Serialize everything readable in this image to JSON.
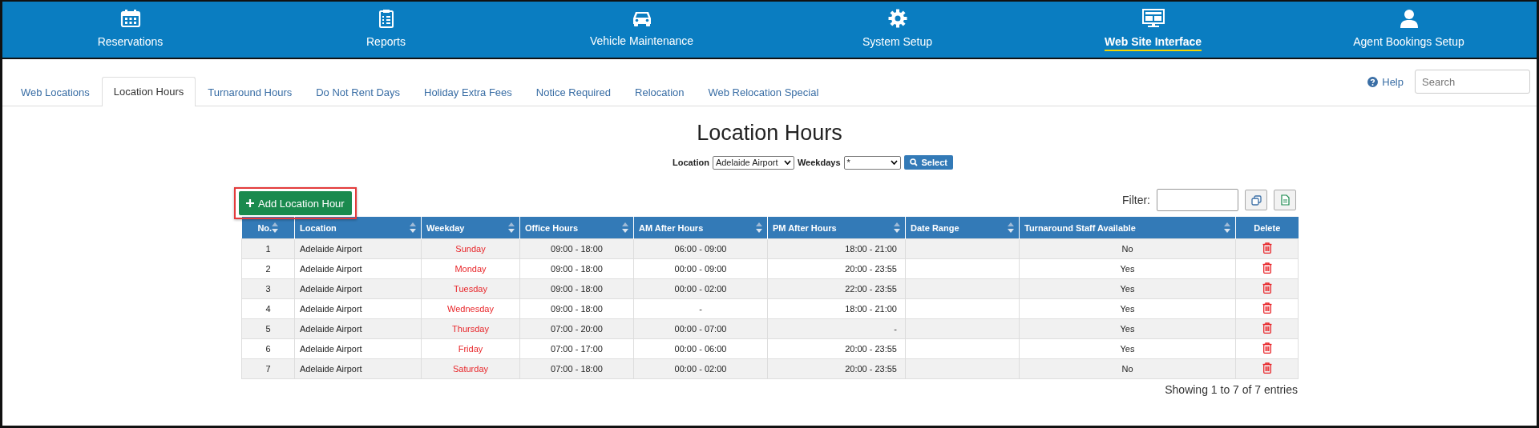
{
  "nav": [
    {
      "label": "Reservations",
      "selected": false
    },
    {
      "label": "Reports",
      "selected": false
    },
    {
      "label": "Vehicle Maintenance",
      "selected": false
    },
    {
      "label": "System Setup",
      "selected": false
    },
    {
      "label": "Web Site Interface",
      "selected": true
    },
    {
      "label": "Agent Bookings Setup",
      "selected": false
    }
  ],
  "tabs": [
    {
      "label": "Web Locations",
      "selected": false
    },
    {
      "label": "Location Hours",
      "selected": true
    },
    {
      "label": "Turnaround Hours",
      "selected": false
    },
    {
      "label": "Do Not Rent Days",
      "selected": false
    },
    {
      "label": "Holiday Extra Fees",
      "selected": false
    },
    {
      "label": "Notice Required",
      "selected": false
    },
    {
      "label": "Relocation",
      "selected": false
    },
    {
      "label": "Web Relocation Special",
      "selected": false
    }
  ],
  "help": "Help",
  "search": {
    "placeholder": "Search"
  },
  "title": "Location Hours",
  "form": {
    "location_label": "Location",
    "location_value": "Adelaide Airport",
    "weekdays_label": "Weekdays",
    "weekdays_value": "*",
    "select_button": "Select"
  },
  "add_button": "Add Location Hour",
  "filter_label": "Filter:",
  "table": {
    "columns": [
      "No.",
      "Location",
      "Weekday",
      "Office Hours",
      "AM After Hours",
      "PM After Hours",
      "Date Range",
      "Turnaround Staff Available",
      "Delete"
    ],
    "rows": [
      [
        "1",
        "Adelaide Airport",
        "Sunday",
        "09:00 - 18:00",
        "06:00 - 09:00",
        "18:00 - 21:00",
        "",
        "No"
      ],
      [
        "2",
        "Adelaide Airport",
        "Monday",
        "09:00 - 18:00",
        "00:00 - 09:00",
        "20:00 - 23:55",
        "",
        "Yes"
      ],
      [
        "3",
        "Adelaide Airport",
        "Tuesday",
        "09:00 - 18:00",
        "00:00 - 02:00",
        "22:00 - 23:55",
        "",
        "Yes"
      ],
      [
        "4",
        "Adelaide Airport",
        "Wednesday",
        "09:00 - 18:00",
        "-",
        "18:00 - 21:00",
        "",
        "Yes"
      ],
      [
        "5",
        "Adelaide Airport",
        "Thursday",
        "07:00 - 20:00",
        "00:00 - 07:00",
        "-",
        "",
        "Yes"
      ],
      [
        "6",
        "Adelaide Airport",
        "Friday",
        "07:00 - 17:00",
        "00:00 - 06:00",
        "20:00 - 23:55",
        "",
        "Yes"
      ],
      [
        "7",
        "Adelaide Airport",
        "Saturday",
        "07:00 - 18:00",
        "00:00 - 02:00",
        "20:00 - 23:55",
        "",
        "No"
      ]
    ]
  },
  "info": "Showing 1 to 7 of 7 entries"
}
